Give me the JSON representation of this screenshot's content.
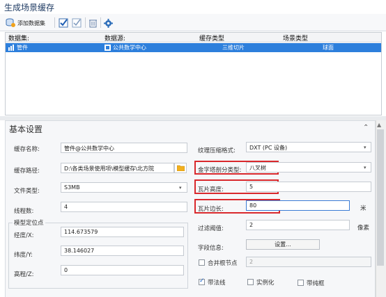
{
  "window": {
    "title": "生成场景缓存"
  },
  "toolbar": {
    "add_dataset_label": "添加数据集",
    "icons": [
      "database-add-icon",
      "check-all-icon",
      "check-icon",
      "delete-icon",
      "settings-icon"
    ]
  },
  "grid": {
    "columns": [
      "数据集:",
      "数据源:",
      "缓存类型",
      "场景类型"
    ],
    "rows": [
      {
        "dataset": "管件",
        "datasource": "公共数学中心",
        "cache_type": "三维切片",
        "scene_type": "球面"
      }
    ]
  },
  "settings": {
    "section_title": "基本设置",
    "cache_name": {
      "label": "缓存名称:",
      "value": "管件@公共数学中心"
    },
    "cache_path": {
      "label": "缓存路径:",
      "value": "D:\\各类场景使用项\\模型缓存\\北方院"
    },
    "file_type": {
      "label": "文件类型:",
      "value": "S3MB"
    },
    "threads": {
      "label": "线程数:",
      "value": "4"
    },
    "model_position": {
      "group_label": "模型定位点",
      "lon": {
        "label": "经度/X:",
        "value": "114.673579"
      },
      "lat": {
        "label": "纬度/Y:",
        "value": "38.146027"
      },
      "elev": {
        "label": "高程/Z:",
        "value": "0"
      }
    },
    "texture_format": {
      "label": "纹理压缩格式:",
      "value": "DXT (PC 设备)"
    },
    "pyramid_type": {
      "label": "金字塔剖分类型:",
      "value": "八叉树"
    },
    "tile_height": {
      "label": "瓦片高度:",
      "value": "5"
    },
    "tile_side": {
      "label": "瓦片边长:",
      "value": "80",
      "unit": "米"
    },
    "filter_threshold": {
      "label": "过滤阈值:",
      "value": "2",
      "unit": "像素"
    },
    "field_info": {
      "label": "字段信息:",
      "button": "设置..."
    },
    "merge_root": {
      "label": "合并根节点",
      "value": "2",
      "checked": false
    },
    "normals": {
      "label": "带法线",
      "checked": true
    },
    "instancing": {
      "label": "实例化",
      "checked": false
    },
    "border": {
      "label": "带纯框",
      "checked": false
    }
  }
}
